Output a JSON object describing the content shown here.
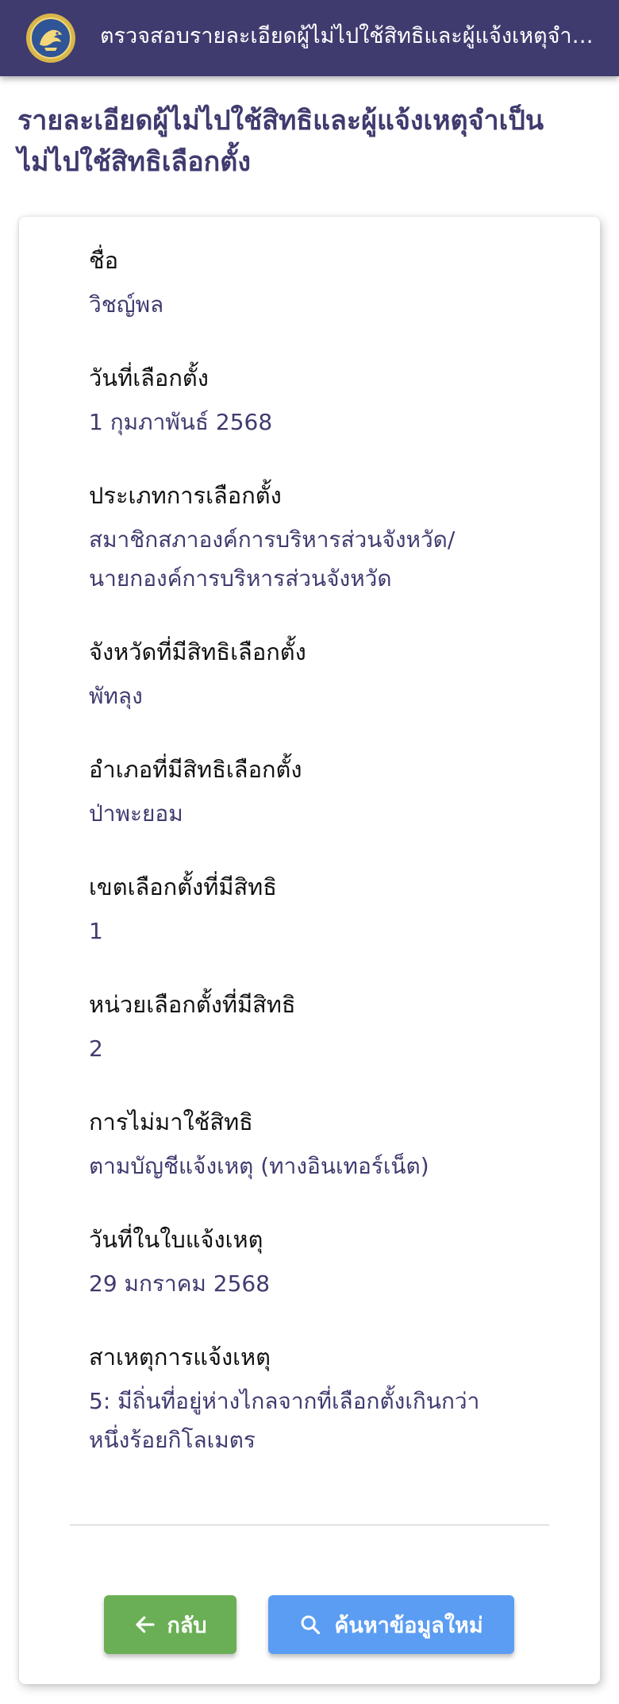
{
  "header": {
    "title": "ตรวจสอบรายละเอียดผู้ไม่ไปใช้สิทธิและผู้แจ้งเหตุจำเป็นไม่ไปใช้สิทธิเลือกตั้ง"
  },
  "page": {
    "title_line1": "รายละเอียดผู้ไม่ไปใช้สิทธิและผู้แจ้งเหตุจำเป็น",
    "title_line2": "ไม่ไปใช้สิทธิเลือกตั้ง"
  },
  "details": {
    "name_label": "ชื่อ",
    "name_value": "วิชญ์พล",
    "election_date_label": "วันที่เลือกตั้ง",
    "election_date_value": "1 กุมภาพันธ์ 2568",
    "election_type_label": "ประเภทการเลือกตั้ง",
    "election_type_value_line1": "สมาชิกสภาองค์การบริหารส่วนจังหวัด/",
    "election_type_value_line2": "นายกองค์การบริหารส่วนจังหวัด",
    "province_label": "จังหวัดที่มีสิทธิเลือกตั้ง",
    "province_value": "พัทลุง",
    "district_label": "อำเภอที่มีสิทธิเลือกตั้ง",
    "district_value": "ป่าพะยอม",
    "constituency_label": "เขตเลือกตั้งที่มีสิทธิ",
    "constituency_value": "1",
    "polling_unit_label": "หน่วยเลือกตั้งที่มีสิทธิ",
    "polling_unit_value": "2",
    "absence_label": "การไม่มาใช้สิทธิ",
    "absence_value": "ตามบัญชีแจ้งเหตุ (ทางอินเทอร์เน็ต)",
    "notice_date_label": "วันที่ในใบแจ้งเหตุ",
    "notice_date_value": "29 มกราคม 2568",
    "reason_label": "สาเหตุการแจ้งเหตุ",
    "reason_value_line1": "5: มีถิ่นที่อยู่ห่างไกลจากที่เลือกตั้งเกินกว่า",
    "reason_value_line2": "หนึ่งร้อยกิโลเมตร"
  },
  "actions": {
    "back_label": "กลับ",
    "new_search_label": "ค้นหาข้อมูลใหม่"
  },
  "icons": {
    "logo": "ect-emblem",
    "back": "arrow-left-icon",
    "search": "search-icon"
  },
  "colors": {
    "header_bg": "#3f3b6f",
    "accent_text": "#3f3b6f",
    "back_button": "#6aaf55",
    "search_button": "#5b9df2"
  }
}
